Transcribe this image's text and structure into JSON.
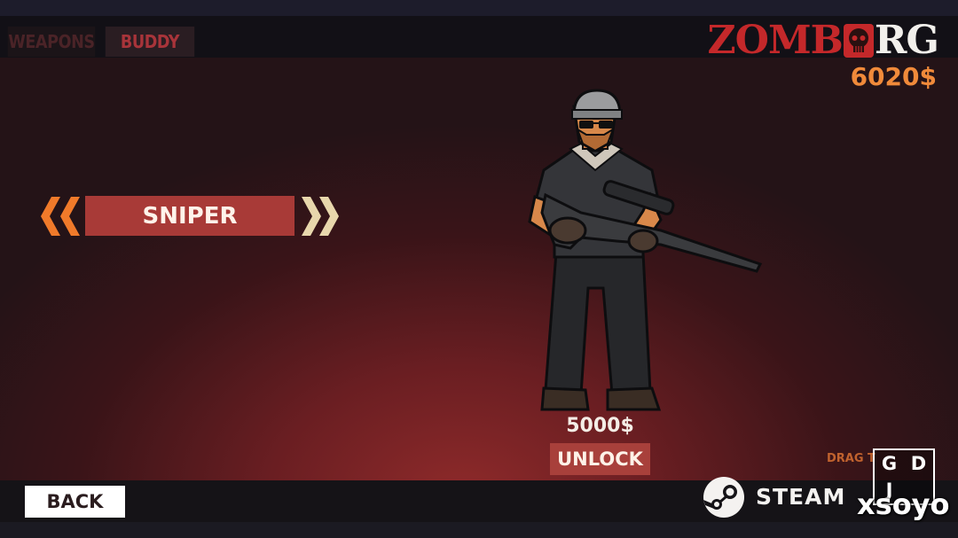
{
  "tabs": [
    {
      "label": "WEAPONS",
      "active": false
    },
    {
      "label": "BUDDY",
      "active": true
    }
  ],
  "logo": {
    "left": "ZOMB",
    "right": "RG",
    "red_color": "#c4282a"
  },
  "currency": {
    "balance": "6020$",
    "color": "#f08a3a"
  },
  "class_selector": {
    "current": "SNIPER",
    "prev_icon": "chevron-double-left-icon",
    "next_icon": "chevron-double-right-icon"
  },
  "buddy": {
    "price": "5000$",
    "unlock_label": "UNLOCK"
  },
  "footer": {
    "back_label": "BACK",
    "steam_label": "STEAM",
    "drag_hint": "DRAG T"
  },
  "watermark": {
    "letters": [
      "G",
      "D",
      "J",
      ""
    ],
    "text": "xsoyo"
  },
  "colors": {
    "accent": "#a83a37",
    "chevron_orange": "#f07a2a",
    "chevron_cream": "#e8d7ac"
  }
}
